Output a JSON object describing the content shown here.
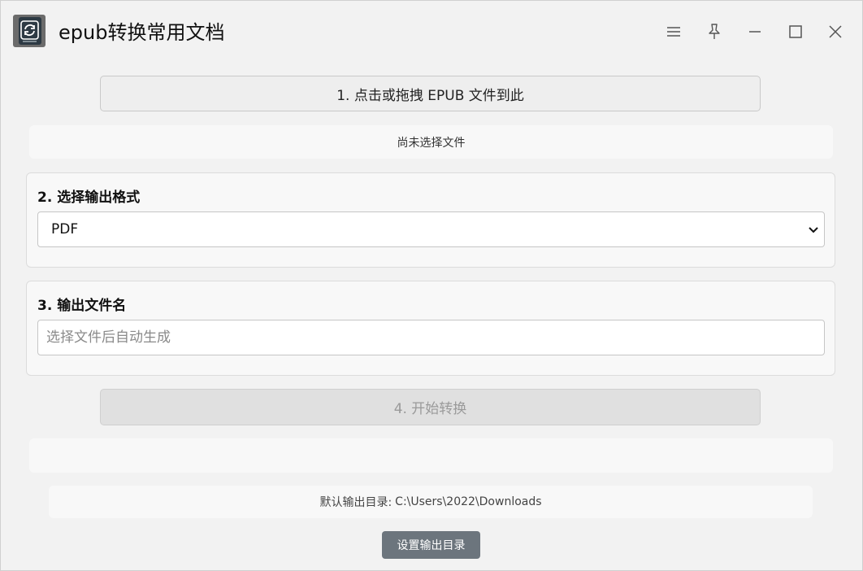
{
  "window": {
    "title": "epub转换常用文档",
    "icon": "refresh-book-icon",
    "controls": [
      "menu-icon",
      "pin-icon",
      "minimize-icon",
      "maximize-icon",
      "close-icon"
    ]
  },
  "step1": {
    "select_button_label": "1. 点击或拖拽 EPUB 文件到此",
    "file_status": "尚未选择文件"
  },
  "step2": {
    "label": "2. 选择输出格式",
    "selected_format": "PDF"
  },
  "step3": {
    "label": "3. 输出文件名",
    "value": "",
    "placeholder": "选择文件后自动生成"
  },
  "step4": {
    "start_button_label": "4. 开始转换",
    "disabled": true
  },
  "output": {
    "dir_label": "默认输出目录:",
    "dir_path": "C:\\Users\\2022\\Downloads",
    "set_dir_button_label": "设置输出目录"
  },
  "colors": {
    "background": "#f2f2f2",
    "card": "#f8f8f8",
    "secondary_button": "#6c757d",
    "disabled_text": "#9a9a9a"
  }
}
